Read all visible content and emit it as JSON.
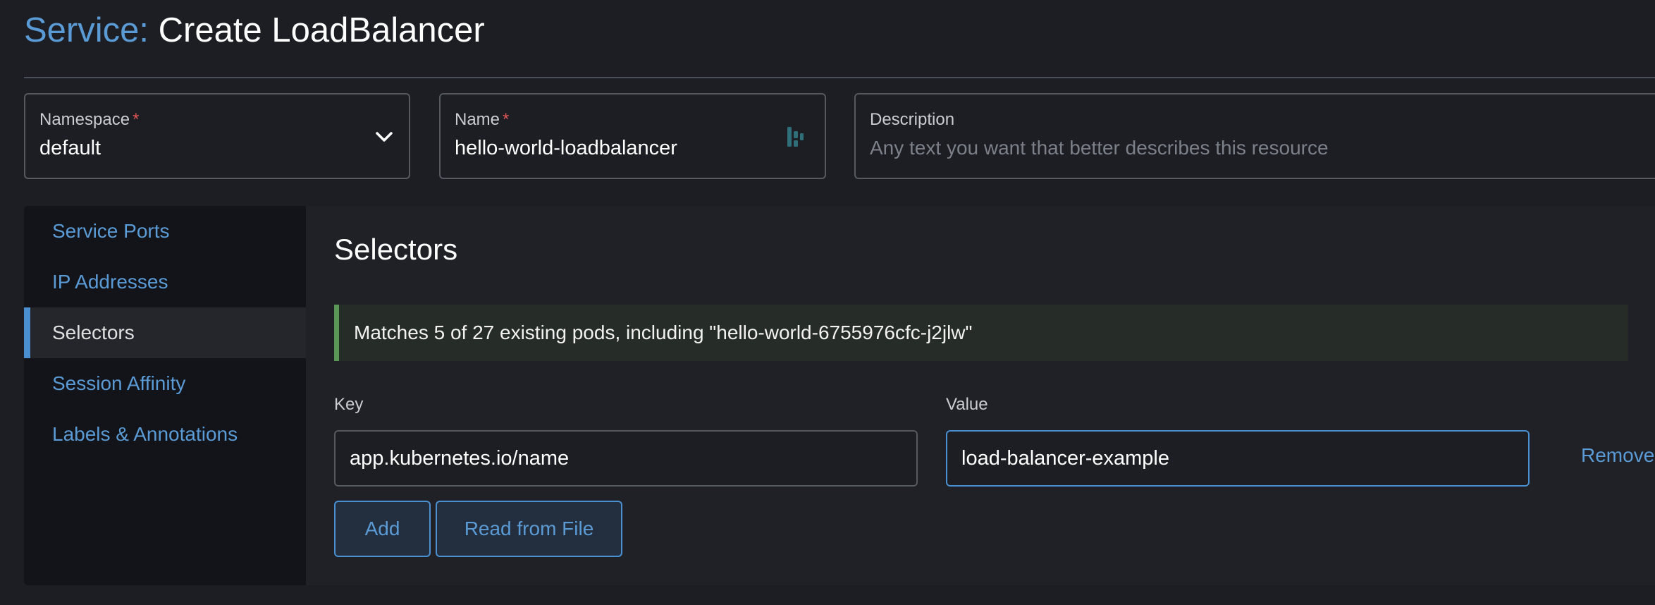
{
  "header": {
    "title_prefix": "Service:",
    "title_main": "Create LoadBalancer"
  },
  "fields": {
    "namespace": {
      "label": "Namespace",
      "required_mark": "*",
      "value": "default"
    },
    "name": {
      "label": "Name",
      "required_mark": "*",
      "value": "hello-world-loadbalancer"
    },
    "description": {
      "label": "Description",
      "placeholder": "Any text you want that better describes this resource"
    }
  },
  "sidebar": {
    "items": [
      {
        "label": "Service Ports",
        "active": false
      },
      {
        "label": "IP Addresses",
        "active": false
      },
      {
        "label": "Selectors",
        "active": true
      },
      {
        "label": "Session Affinity",
        "active": false
      },
      {
        "label": "Labels & Annotations",
        "active": false
      }
    ]
  },
  "selectors": {
    "title": "Selectors",
    "banner": "Matches 5 of 27 existing pods, including \"hello-world-6755976cfc-j2jlw\"",
    "key_label": "Key",
    "value_label": "Value",
    "rows": [
      {
        "key": "app.kubernetes.io/name",
        "value": "load-balancer-example",
        "remove_label": "Remove"
      }
    ],
    "add_label": "Add",
    "read_file_label": "Read from File"
  },
  "colors": {
    "accent": "#5b9bd5",
    "success": "#5a9656",
    "required": "#e05555",
    "background": "#1c1e24"
  }
}
